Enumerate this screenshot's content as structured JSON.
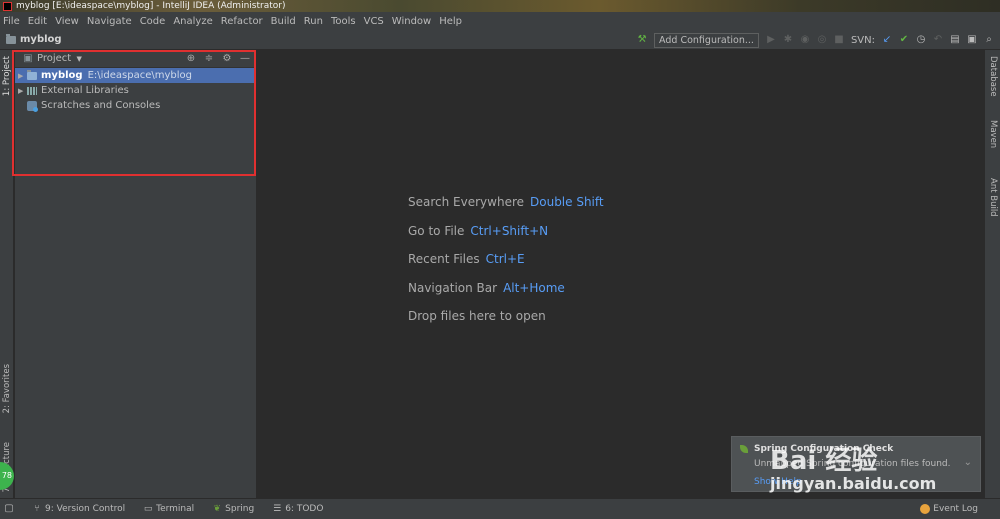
{
  "window": {
    "title": "myblog [E:\\ideaspace\\myblog] - IntelliJ IDEA (Administrator)"
  },
  "menu": [
    "File",
    "Edit",
    "View",
    "Navigate",
    "Code",
    "Analyze",
    "Refactor",
    "Build",
    "Run",
    "Tools",
    "VCS",
    "Window",
    "Help"
  ],
  "navbar": {
    "project": "myblog",
    "add_configuration": "Add Configuration...",
    "svn_label": "SVN:"
  },
  "left_tabs": {
    "project": "1: Project",
    "favorites": "2: Favorites",
    "structure": "7: Structure",
    "badge": "78"
  },
  "right_tabs": {
    "database": "Database",
    "maven": "Maven",
    "ant": "Ant Build"
  },
  "project_panel": {
    "title": "Project",
    "tree": [
      {
        "name": "myblog",
        "path": "E:\\ideaspace\\myblog"
      },
      {
        "name": "External Libraries"
      },
      {
        "name": "Scratches and Consoles"
      }
    ]
  },
  "hints": [
    {
      "label": "Search Everywhere",
      "key": "Double Shift"
    },
    {
      "label": "Go to File",
      "key": "Ctrl+Shift+N"
    },
    {
      "label": "Recent Files",
      "key": "Ctrl+E"
    },
    {
      "label": "Navigation Bar",
      "key": "Alt+Home"
    },
    {
      "label": "Drop files here to open",
      "key": ""
    }
  ],
  "status_bar": {
    "version_control": "9: Version Control",
    "terminal": "Terminal",
    "spring": "Spring",
    "todo": "6: TODO",
    "event_log": "Event Log"
  },
  "notification": {
    "title": "Spring Configuration Check",
    "body": "Unmapped Spring configuration files found.",
    "link": "Show Help"
  },
  "watermark": {
    "logo": "Bai 经验",
    "url": "jingyan.baidu.com"
  }
}
